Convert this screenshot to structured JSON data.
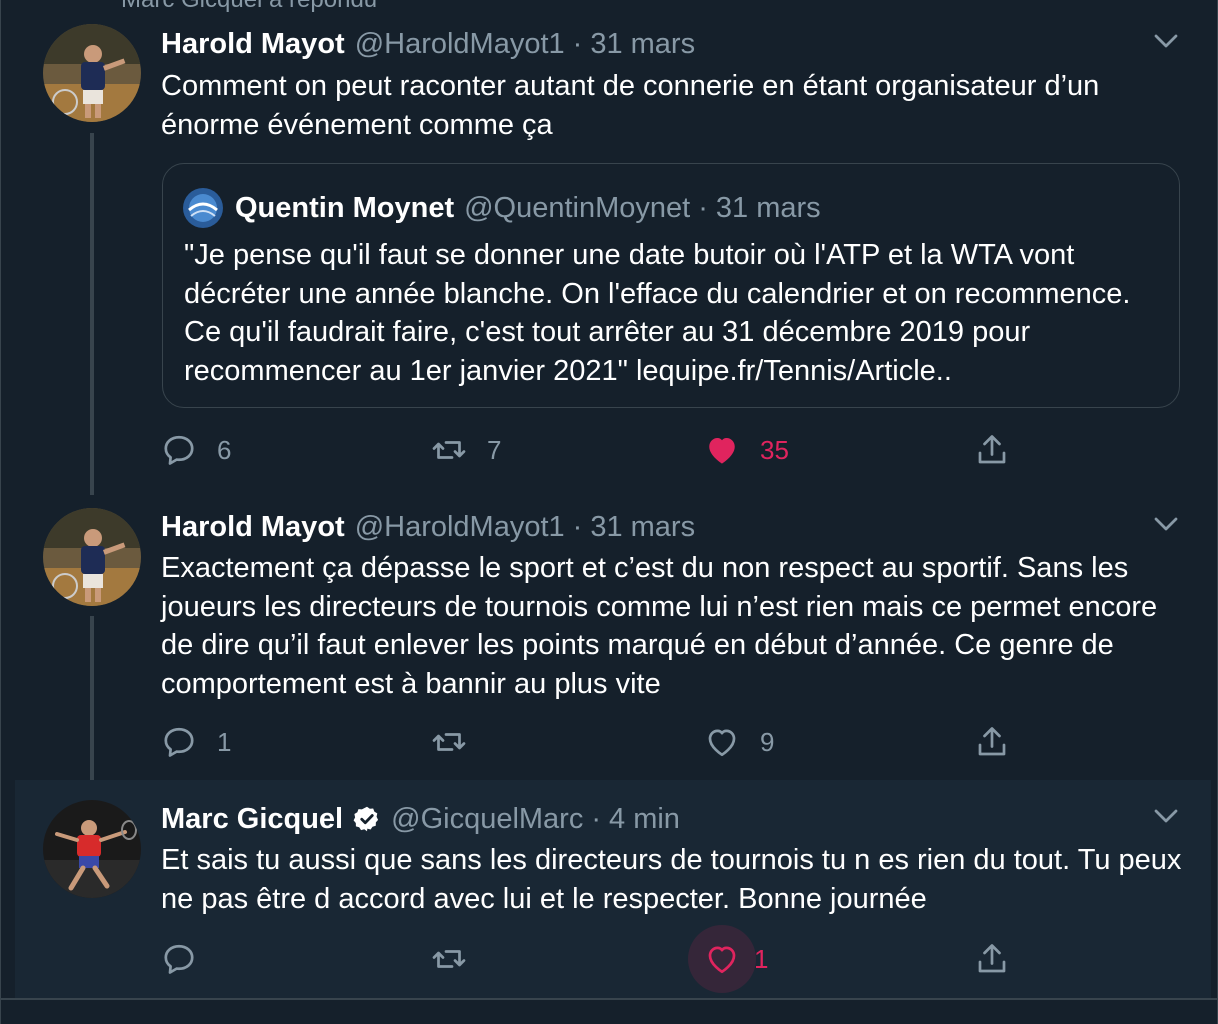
{
  "context": {
    "text": "Marc Gicquel a répondu"
  },
  "tweets": [
    {
      "name": "Harold Mayot",
      "handle": "@HaroldMayot1",
      "separator": "·",
      "time": "31 mars",
      "text": "Comment on peut raconter autant de connerie en étant organisateur d’un énorme événement comme ça",
      "quote": {
        "name": "Quentin Moynet",
        "handle": "@QuentinMoynet",
        "separator": "·",
        "time": "31 mars",
        "text": "\"Je pense qu'il faut se donner une date butoir où l'ATP et la WTA vont décréter une année blanche. On l'efface du calendrier et on recommence. Ce qu'il faudrait faire, c'est tout arrêter au 31 décembre 2019 pour recommencer au 1er janvier 2021\" lequipe.fr/Tennis/Article.."
      },
      "actions": {
        "replies": "6",
        "retweets": "7",
        "likes": "35",
        "liked": true
      }
    },
    {
      "name": "Harold Mayot",
      "handle": "@HaroldMayot1",
      "separator": "·",
      "time": "31 mars",
      "text": "Exactement ça dépasse le sport et c’est du non respect au sportif. Sans les joueurs les directeurs de tournois comme lui n’est rien mais ce permet encore de dire qu’il faut enlever les points marqué en début d’année. Ce genre de comportement est à bannir au plus vite",
      "actions": {
        "replies": "1",
        "retweets": "",
        "likes": "9",
        "liked": false
      }
    },
    {
      "name": "Marc Gicquel",
      "verified": true,
      "handle": "@GicquelMarc",
      "separator": "·",
      "time": "4 min",
      "text": "Et sais tu aussi que sans les directeurs de tournois tu n es rien du tout. Tu peux ne pas être d accord avec lui et le respecter.  Bonne journée",
      "actions": {
        "replies": "",
        "retweets": "",
        "likes": "1",
        "liked": false,
        "like_hover": true
      }
    }
  ],
  "colors": {
    "background": "#15202b",
    "highlight": "#192734",
    "secondary_text": "#8899a6",
    "like": "#e0245e",
    "verified": "#ffffff",
    "border": "#38444d"
  },
  "icons": {
    "reply": "reply-icon",
    "retweet": "retweet-icon",
    "like": "heart-icon",
    "share": "share-icon",
    "more": "chevron-down-icon",
    "verified": "verified-badge-icon"
  }
}
